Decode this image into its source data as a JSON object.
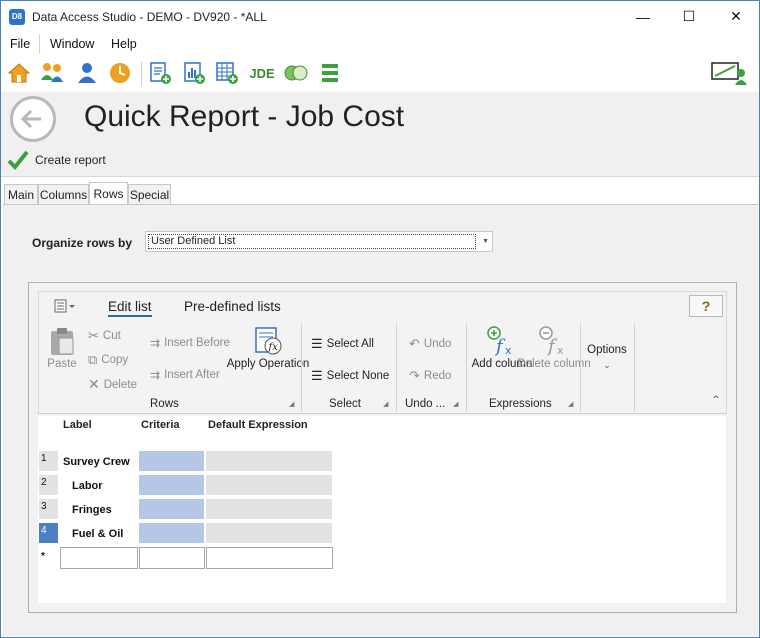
{
  "window": {
    "app_icon_text": "D8",
    "title": "Data Access Studio - DEMO - DV920 - *ALL",
    "minimize": "—",
    "maximize": "☐",
    "close": "✕"
  },
  "menu": {
    "items": [
      "File",
      "Window",
      "Help"
    ]
  },
  "toolbar": {
    "jde_label": "JDE"
  },
  "page": {
    "title": "Quick Report - Job Cost"
  },
  "actions": {
    "create_report": "Create report"
  },
  "tabs": [
    {
      "label": "Main",
      "active": false
    },
    {
      "label": "Columns",
      "active": false
    },
    {
      "label": "Rows",
      "active": true
    },
    {
      "label": "Special",
      "active": false
    }
  ],
  "organize": {
    "label": "Organize rows by",
    "value": "User Defined List"
  },
  "ribbon": {
    "tabs": [
      "Edit list",
      "Pre-defined lists"
    ],
    "help": "?",
    "rows_group": {
      "label": "Rows",
      "paste": "Paste",
      "cut": "Cut",
      "copy": "Copy",
      "delete": "Delete",
      "insert_before": "Insert Before",
      "insert_after": "Insert After",
      "apply_operation": "Apply Operation"
    },
    "select_group": {
      "label": "Select",
      "select_all": "Select All",
      "select_none": "Select None"
    },
    "undo_group": {
      "label": "Undo ...",
      "undo": "Undo",
      "redo": "Redo"
    },
    "expressions_group": {
      "label": "Expressions",
      "add_column": "Add column",
      "delete_column": "Delete column"
    },
    "options": "Options"
  },
  "grid": {
    "columns": [
      "Label",
      "Criteria",
      "Default Expression"
    ],
    "rows": [
      {
        "num": "1",
        "label": "Survey Crew",
        "selected": false
      },
      {
        "num": "2",
        "label": "Labor",
        "selected": false
      },
      {
        "num": "3",
        "label": "Fringes",
        "selected": false
      },
      {
        "num": "4",
        "label": "Fuel & Oil",
        "selected": true
      }
    ],
    "new_row_marker": "*"
  }
}
